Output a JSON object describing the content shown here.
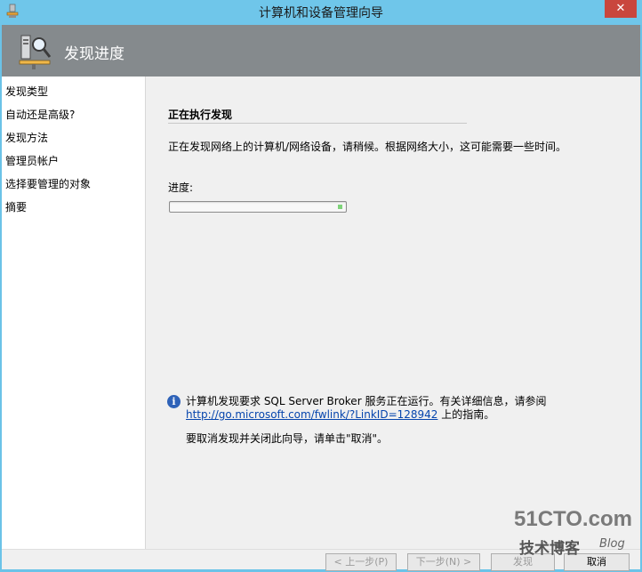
{
  "window": {
    "title": "计算机和设备管理向导",
    "close_label": "✕"
  },
  "header": {
    "title": "发现进度",
    "icon": "computer-magnifier-icon"
  },
  "sidebar": {
    "items": [
      {
        "label": "发现类型"
      },
      {
        "label": "自动还是高级?"
      },
      {
        "label": "发现方法"
      },
      {
        "label": "管理员帐户"
      },
      {
        "label": "选择要管理的对象"
      },
      {
        "label": "摘要"
      }
    ]
  },
  "main": {
    "section_title": "正在执行发现",
    "description": "正在发现网络上的计算机/网络设备，请稍候。根据网络大小，这可能需要一些时间。",
    "progress_label": "进度:",
    "progress_value": 0.02,
    "info_icon": "info-icon",
    "info_text": "计算机发现要求 SQL Server Broker 服务正在运行。有关详细信息，请参阅",
    "info_link": "http://go.microsoft.com/fwlink/?LinkID=128942",
    "info_suffix": "上的指南。",
    "cancel_note": "要取消发现并关闭此向导，请单击\"取消\"。"
  },
  "footer": {
    "prev_label": "< 上一步(P)",
    "next_label": "下一步(N) >",
    "discover_label": "发现",
    "cancel_label": "取消"
  },
  "watermark": {
    "top": "51CTO.com",
    "bottom": "技术博客",
    "blog": "Blog"
  }
}
